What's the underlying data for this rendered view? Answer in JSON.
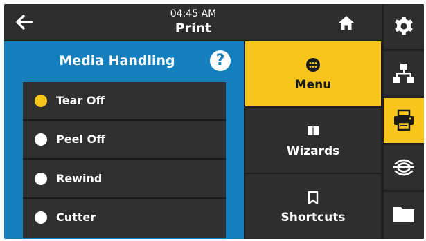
{
  "header": {
    "time": "04:45 AM",
    "title": "Print"
  },
  "panel": {
    "title": "Media Handling",
    "help_label": "?",
    "options": [
      {
        "label": "Tear Off",
        "selected": true
      },
      {
        "label": "Peel Off",
        "selected": false
      },
      {
        "label": "Rewind",
        "selected": false
      },
      {
        "label": "Cutter",
        "selected": false
      }
    ]
  },
  "nav": {
    "items": [
      {
        "label": "Menu",
        "icon": "menu-dots-icon",
        "active": true
      },
      {
        "label": "Wizards",
        "icon": "book-icon",
        "active": false
      },
      {
        "label": "Shortcuts",
        "icon": "bookmark-icon",
        "active": false
      }
    ]
  },
  "rail": {
    "items": [
      {
        "icon": "gear-icon",
        "active": false
      },
      {
        "icon": "network-icon",
        "active": false
      },
      {
        "icon": "printer-icon",
        "active": true
      },
      {
        "icon": "rfid-icon",
        "active": false
      },
      {
        "icon": "folder-icon",
        "active": false
      }
    ]
  },
  "colors": {
    "accent": "#f8c51c",
    "panel_blue": "#1380bd",
    "dark": "#2e2e2e"
  }
}
